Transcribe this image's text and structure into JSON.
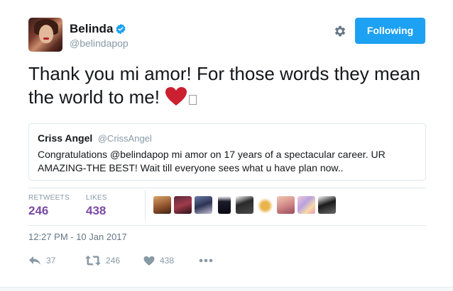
{
  "profile": {
    "display_name": "Belinda",
    "handle": "@belindapop",
    "verified": true
  },
  "header": {
    "follow_label": "Following"
  },
  "tweet": {
    "text": "Thank you mi amor! For those words they mean the world to me!",
    "emoji": "red-heart"
  },
  "quoted_tweet": {
    "name": "Criss Angel",
    "handle": "@CrissAngel",
    "text": "Congratulations @belindapop mi amor on 17 years of a spectacular career. UR AMAZING-THE BEST! Wait till everyone sees what u have plan now.."
  },
  "stats": {
    "retweets_label": "RETWEETS",
    "retweets_value": "246",
    "likes_label": "LIKES",
    "likes_value": "438"
  },
  "timestamp": "12:27 PM - 10 Jan 2017",
  "actions": {
    "reply_count": "37",
    "retweet_count": "246",
    "like_count": "438"
  },
  "colors": {
    "accent": "#1da1f2",
    "stat_value": "#7b4aa3",
    "heart": "#e0245e",
    "muted": "#8899a6"
  }
}
